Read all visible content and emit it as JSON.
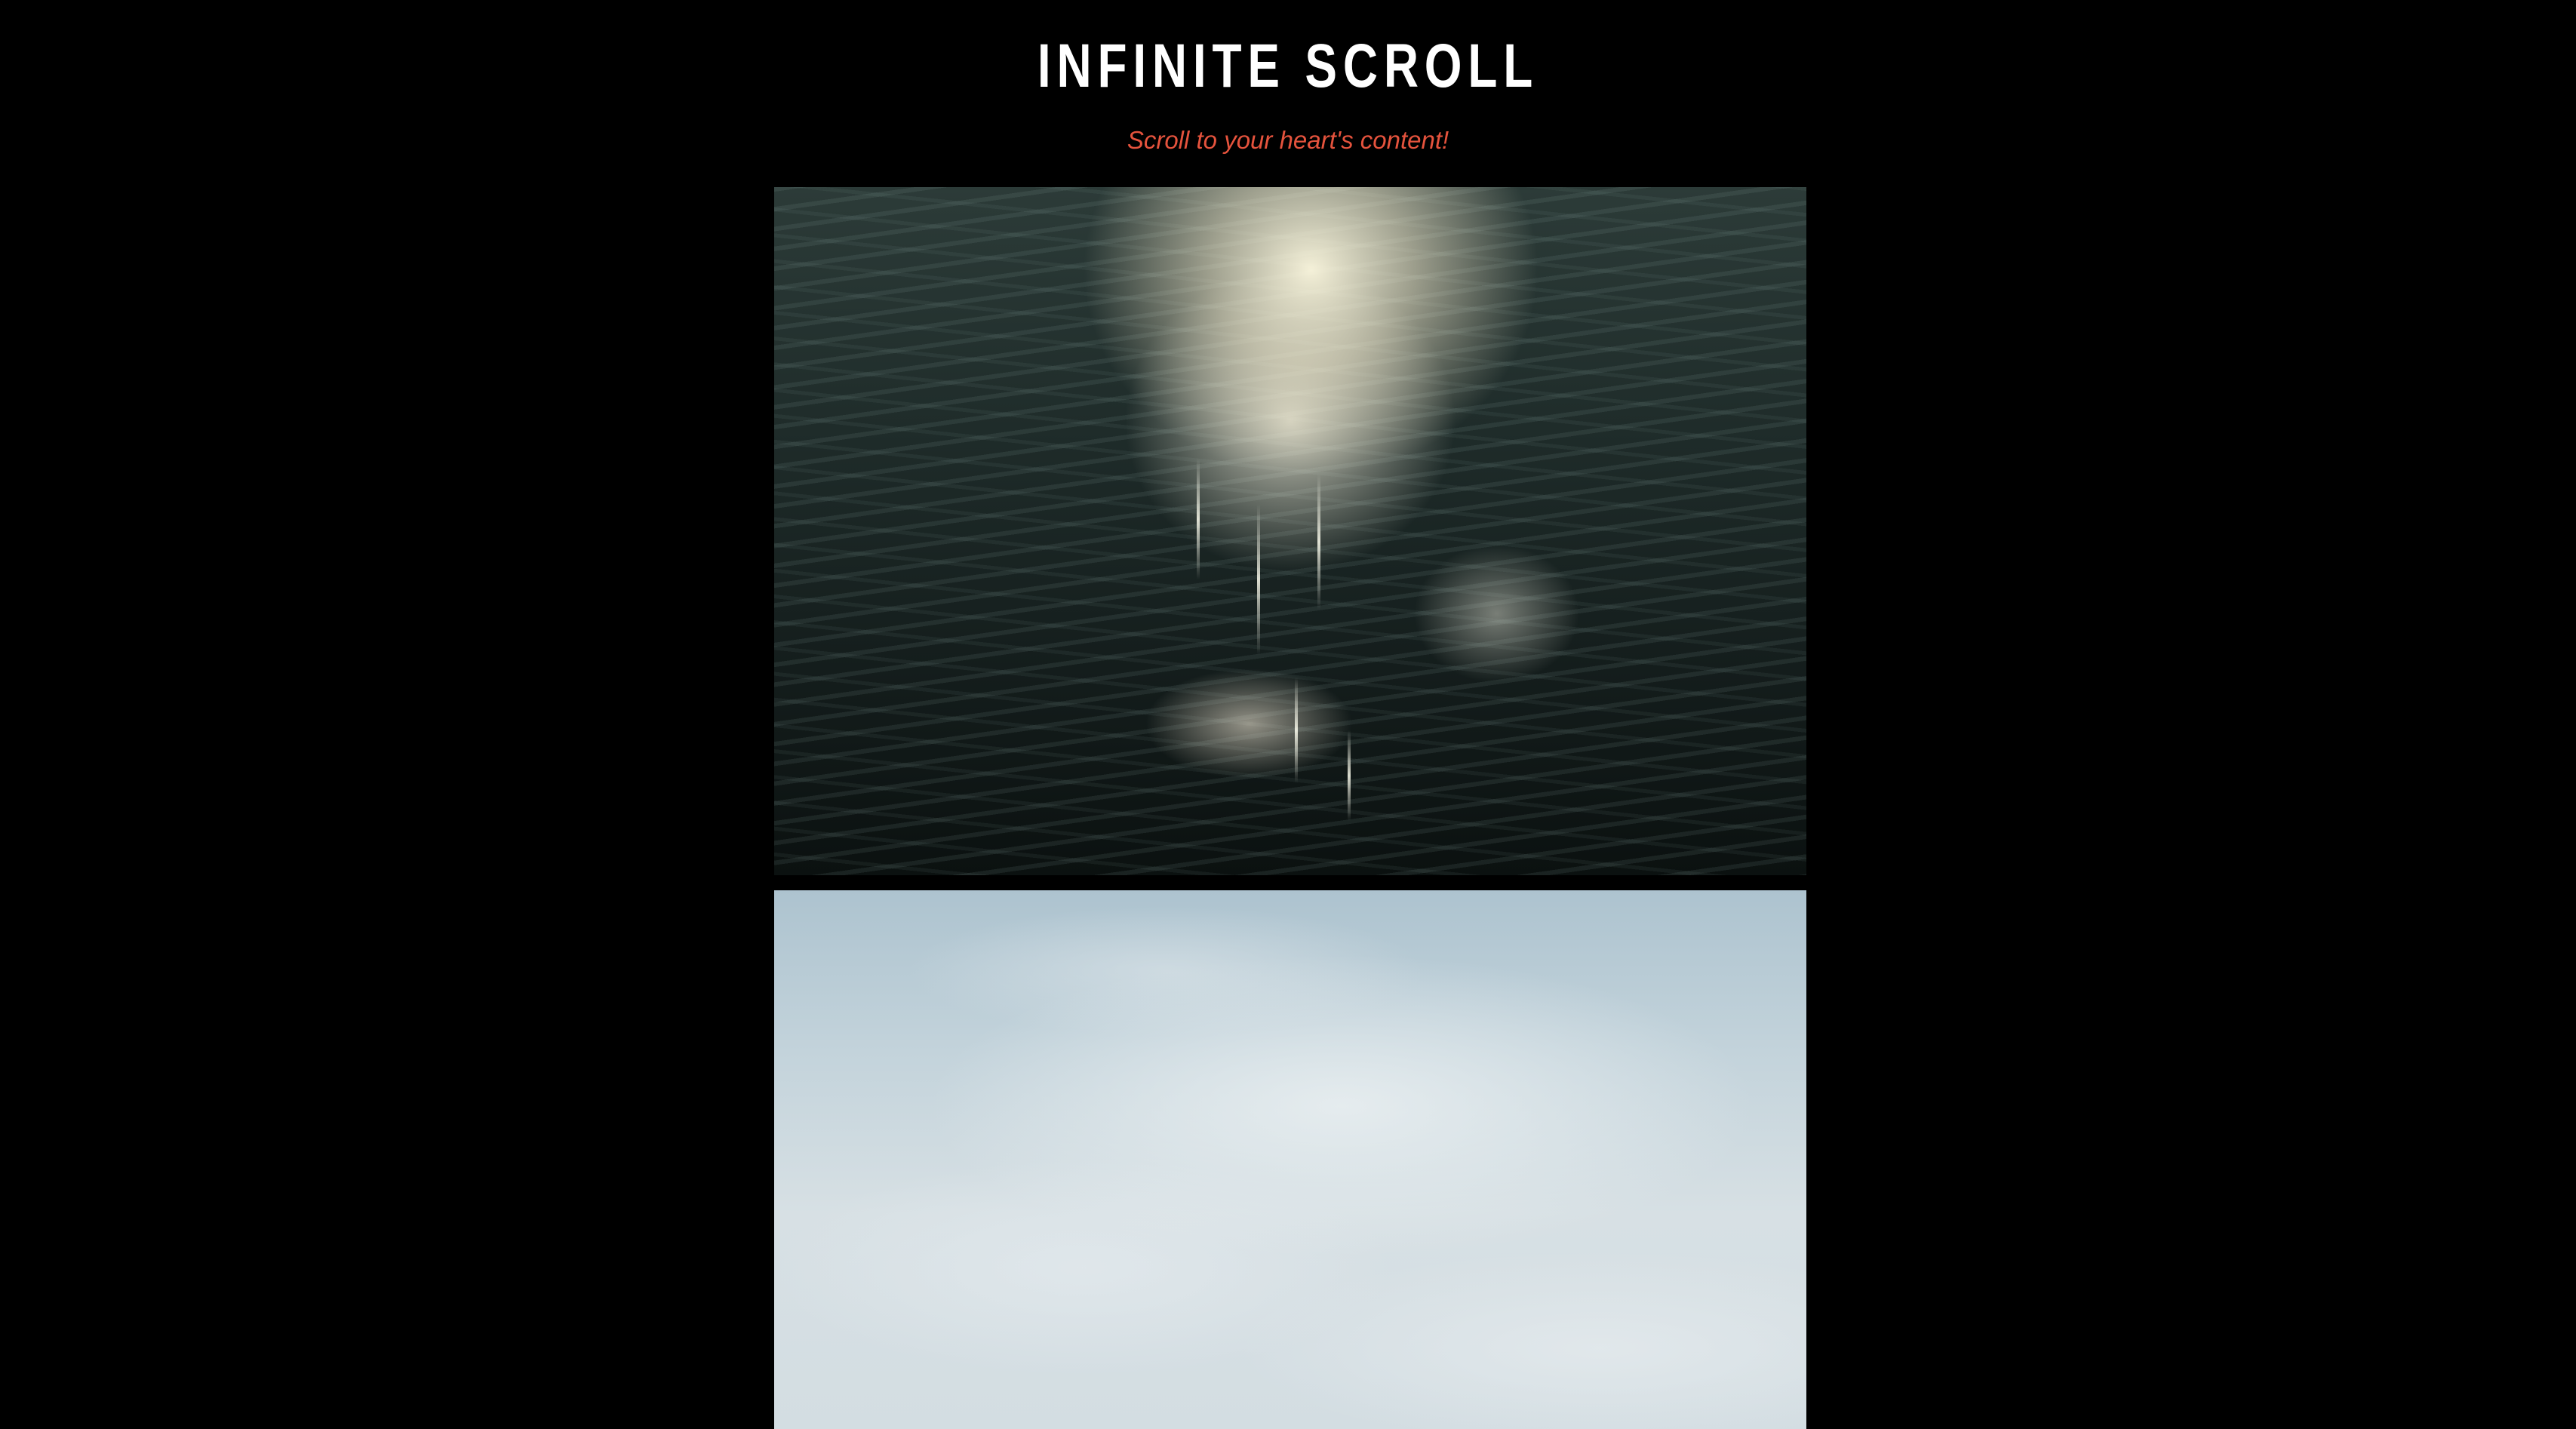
{
  "header": {
    "title": "INFINITE SCROLL",
    "subtitle": "Scroll to your heart's content!"
  },
  "feed": {
    "items": [
      {
        "image_subject": "sunlit-ocean-water-photo"
      },
      {
        "image_subject": "cloudy-sky-photo"
      }
    ]
  },
  "colors": {
    "background": "#000000",
    "title": "#ffffff",
    "subtitle_accent": "#e5533d"
  }
}
